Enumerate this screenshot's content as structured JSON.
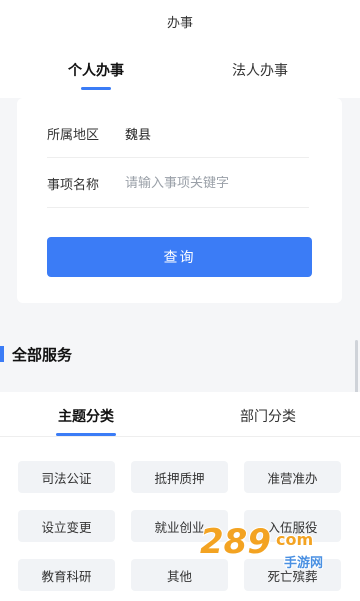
{
  "header": {
    "title": "办事"
  },
  "top_tabs": [
    {
      "label": "个人办事",
      "active": true
    },
    {
      "label": "法人办事",
      "active": false
    }
  ],
  "form": {
    "region_label": "所属地区",
    "region_value": "魏县",
    "item_label": "事项名称",
    "item_placeholder": "请输入事项关键字",
    "query_button": "查询"
  },
  "section": {
    "title": "全部服务"
  },
  "service_tabs": [
    {
      "label": "主题分类",
      "active": true
    },
    {
      "label": "部门分类",
      "active": false
    }
  ],
  "service_chips": [
    "司法公证",
    "抵押质押",
    "准营准办",
    "设立变更",
    "就业创业",
    "入伍服役",
    "教育科研",
    "其他",
    "死亡殡葬"
  ],
  "watermark": {
    "text": "289",
    "suffix": "com",
    "subtitle": "手游网"
  },
  "colors": {
    "accent": "#3b7cf6",
    "chip_bg": "#f1f3f6",
    "watermark": "#f3a322"
  }
}
